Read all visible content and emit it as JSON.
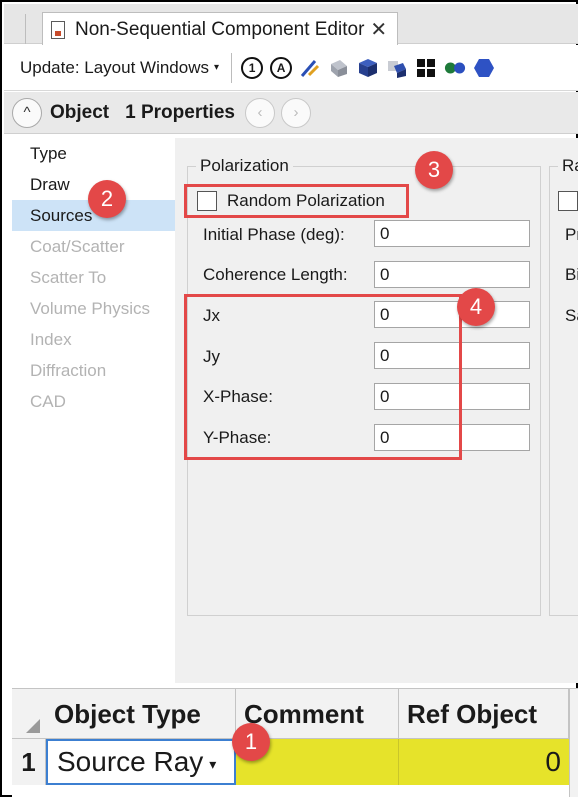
{
  "tab": {
    "title": "Non-Sequential Component Editor",
    "close": "✕"
  },
  "toolbar": {
    "update_label": "Update: Layout Windows",
    "update_caret": "▾",
    "icons": [
      "refresh-icon",
      "auto-update-icon",
      "ray-trace-icon",
      "shaded-model-icon",
      "cube-icon",
      "object-icon",
      "grid-icon",
      "dots-icon",
      "hexagon-icon"
    ]
  },
  "object_nav": {
    "collapse_glyph": "^",
    "object_label": "Object",
    "properties_label": "1 Properties",
    "prev_glyph": "‹",
    "next_glyph": "›"
  },
  "categories": [
    {
      "label": "Type",
      "state": "enabled"
    },
    {
      "label": "Draw",
      "state": "enabled"
    },
    {
      "label": "Sources",
      "state": "selected"
    },
    {
      "label": "Coat/Scatter",
      "state": "disabled"
    },
    {
      "label": "Scatter To",
      "state": "disabled"
    },
    {
      "label": "Volume Physics",
      "state": "disabled"
    },
    {
      "label": "Index",
      "state": "disabled"
    },
    {
      "label": "Diffraction",
      "state": "disabled"
    },
    {
      "label": "CAD",
      "state": "disabled"
    }
  ],
  "polarization": {
    "legend": "Polarization",
    "random_label": "Random Polarization",
    "random_checked": false,
    "fields": [
      {
        "label": "Initial Phase (deg):",
        "value": "0"
      },
      {
        "label": "Coherence Length:",
        "value": "0"
      },
      {
        "label": "Jx",
        "value": "0"
      },
      {
        "label": "Jy",
        "value": "0"
      },
      {
        "label": "X-Phase:",
        "value": "0"
      },
      {
        "label": "Y-Phase:",
        "value": "0"
      }
    ]
  },
  "right_group": {
    "legend": "Ra",
    "labels": [
      "Pr",
      "Bi",
      "Sa"
    ]
  },
  "callouts": [
    "1",
    "2",
    "3",
    "4"
  ],
  "grid": {
    "headers": [
      "Object Type",
      "Comment",
      "Ref Object"
    ],
    "rows": [
      {
        "num": "1",
        "type": "Source Ray",
        "comment": "",
        "ref_object": "0"
      }
    ],
    "type_caret": "▾"
  },
  "colors": {
    "callout": "#e34848",
    "selection": "#cde3f7",
    "highlight_cell": "#e6e32a",
    "active_border": "#3c7fd1"
  }
}
